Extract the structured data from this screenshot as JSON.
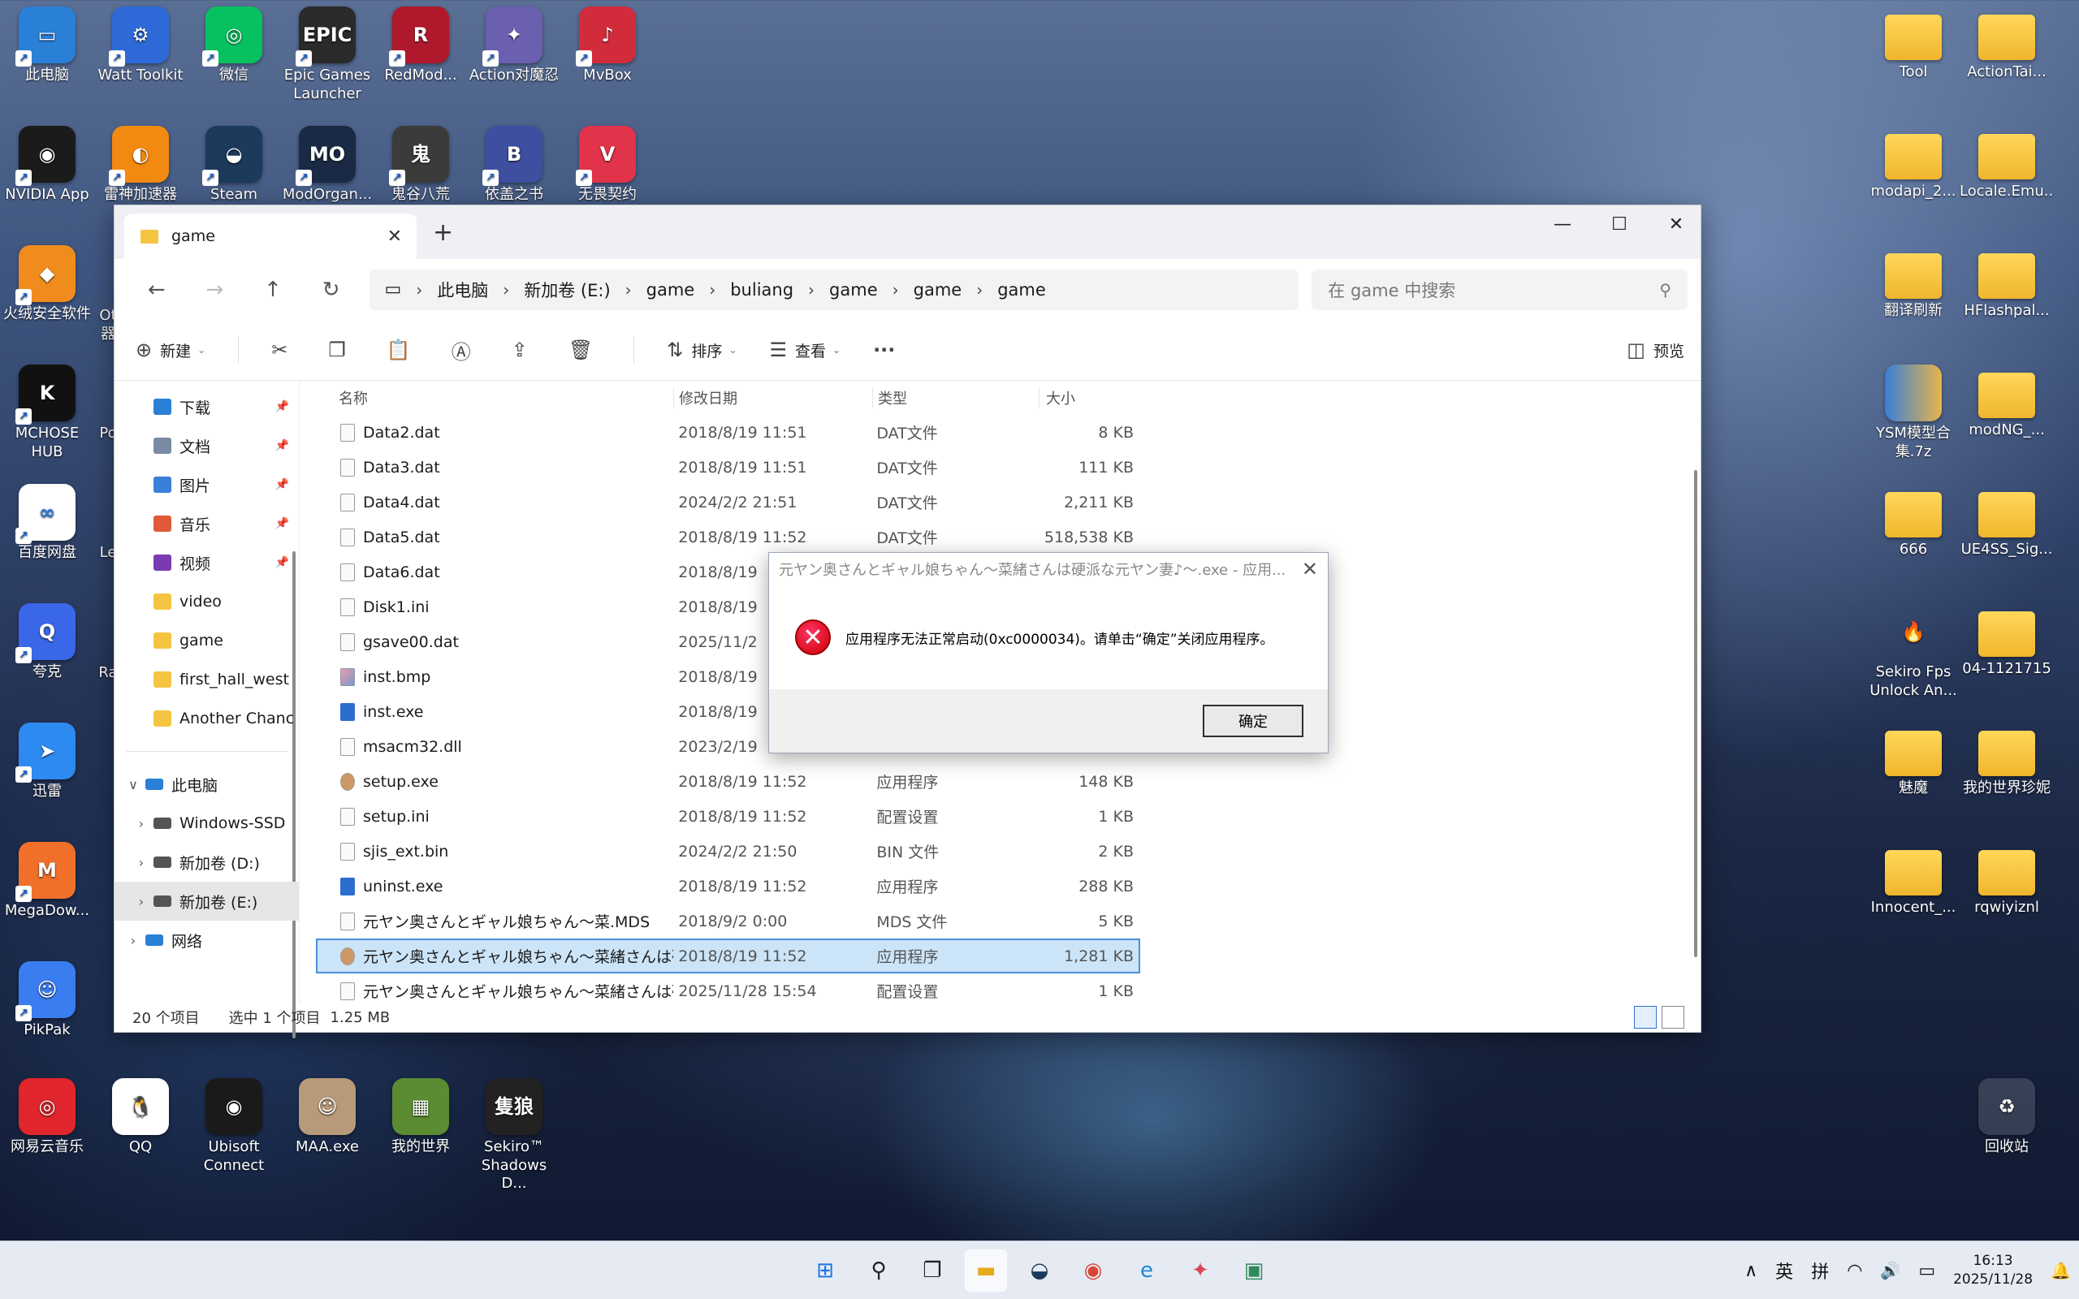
{
  "desktop": {
    "left_icons": [
      {
        "label": "此电脑",
        "icon": "computer-icon",
        "color": "#2a7fd6",
        "glyph": "▭"
      },
      {
        "label": "Watt Toolkit",
        "icon": "watt-toolkit-icon",
        "color": "#2d6ad8",
        "glyph": "⚙"
      },
      {
        "label": "微信",
        "icon": "wechat-icon",
        "color": "#07c160",
        "glyph": "◎"
      },
      {
        "label": "Epic Games Launcher",
        "icon": "epic-games-icon",
        "color": "#2a2a2a",
        "glyph": "EPIC"
      },
      {
        "label": "RedMod...",
        "icon": "redmod-icon",
        "color": "#b0182c",
        "glyph": "R"
      },
      {
        "label": "Action对魔忍",
        "icon": "action-game-icon",
        "color": "#6b5fb0",
        "glyph": "✦"
      },
      {
        "label": "MvBox",
        "icon": "mvbox-icon",
        "color": "#d22c3c",
        "glyph": "♪"
      },
      {
        "label": "NVIDIA App",
        "icon": "nvidia-icon",
        "color": "#1b1b1b",
        "glyph": "◉"
      },
      {
        "label": "雷神加速器",
        "icon": "leishen-icon",
        "color": "#f28a12",
        "glyph": "◐"
      },
      {
        "label": "Steam",
        "icon": "steam-icon",
        "color": "#1b3a5c",
        "glyph": "◒"
      },
      {
        "label": "ModOrgan...",
        "icon": "mod-organizer-icon",
        "color": "#1a2a44",
        "glyph": "MO"
      },
      {
        "label": "鬼谷八荒",
        "icon": "guigu-icon",
        "color": "#3b3b3b",
        "glyph": "鬼"
      },
      {
        "label": "依盖之书",
        "icon": "yigai-icon",
        "color": "#3e4fa0",
        "glyph": "B"
      },
      {
        "label": "无畏契约",
        "icon": "valorant-icon",
        "color": "#e1334a",
        "glyph": "V"
      },
      {
        "label": "火绒安全软件",
        "icon": "huorong-icon",
        "color": "#f08c1e",
        "glyph": "◆"
      },
      {
        "label": "MCHOSE HUB",
        "icon": "mchose-icon",
        "color": "#111111",
        "glyph": "K"
      },
      {
        "label": "百度网盘",
        "icon": "baidu-netdisk-icon",
        "color": "#ffffff",
        "glyph": "∞"
      },
      {
        "label": "夸克",
        "icon": "quark-icon",
        "color": "#3a67e8",
        "glyph": "Q"
      },
      {
        "label": "迅雷",
        "icon": "xunlei-icon",
        "color": "#2d8af0",
        "glyph": "➤"
      },
      {
        "label": "MegaDow...",
        "icon": "megadownloader-icon",
        "color": "#f0702a",
        "glyph": "M"
      },
      {
        "label": "PikPak",
        "icon": "pikpak-icon",
        "color": "#3a7df0",
        "glyph": "☺"
      }
    ],
    "partial_labels": [
      "Ot 器",
      "Po",
      "Le",
      "Ra"
    ],
    "bottom_icons": [
      {
        "label": "网易云音乐",
        "icon": "netease-music-icon",
        "color": "#e0262c",
        "glyph": "◎"
      },
      {
        "label": "QQ",
        "icon": "qq-icon",
        "color": "#ffffff",
        "glyph": "🐧"
      },
      {
        "label": "Ubisoft Connect",
        "icon": "ubisoft-icon",
        "color": "#1a1a1a",
        "glyph": "◉"
      },
      {
        "label": "MAA.exe",
        "icon": "maa-icon",
        "color": "#b89a7a",
        "glyph": "☺"
      },
      {
        "label": "我的世界",
        "icon": "minecraft-icon",
        "color": "#5b8c32",
        "glyph": "▦"
      },
      {
        "label": "Sekiro™ Shadows D...",
        "icon": "sekiro-icon",
        "color": "#222222",
        "glyph": "隻狼"
      }
    ],
    "right_icons": [
      {
        "label": "Tool",
        "icon": "folder-icon"
      },
      {
        "label": "ActionTai...",
        "icon": "folder-icon"
      },
      {
        "label": "modapi_2...",
        "icon": "folder-icon"
      },
      {
        "label": "Locale.Emu...",
        "icon": "folder-icon"
      },
      {
        "label": "翻译刷新",
        "icon": "folder-icon"
      },
      {
        "label": "HFlashpal...",
        "icon": "folder-icon"
      },
      {
        "label": "YSM模型合集.7z",
        "icon": "archive-icon"
      },
      {
        "label": "modNG_...",
        "icon": "folder-icon"
      },
      {
        "label": "666",
        "icon": "folder-icon"
      },
      {
        "label": "UE4SS_Sig...",
        "icon": "folder-icon"
      },
      {
        "label": "Sekiro Fps Unlock An...",
        "icon": "sekiro-fps-icon"
      },
      {
        "label": "04-1121715",
        "icon": "folder-icon"
      },
      {
        "label": "魅魔",
        "icon": "folder-icon"
      },
      {
        "label": "我的世界珍妮",
        "icon": "folder-icon"
      },
      {
        "label": "Innocent_...",
        "icon": "folder-icon"
      },
      {
        "label": "rqwiyiznl",
        "icon": "folder-icon"
      },
      {
        "label": "回收站",
        "icon": "recycle-bin-icon"
      }
    ]
  },
  "explorer": {
    "tab_title": "game",
    "breadcrumb": [
      "此电脑",
      "新加卷 (E:)",
      "game",
      "buliang",
      "game",
      "game",
      "game"
    ],
    "search_placeholder": "在 game 中搜索",
    "toolbar": {
      "new": "新建",
      "sort": "排序",
      "view": "查看",
      "more": "···",
      "preview": "预览"
    },
    "sidebar": [
      {
        "label": "下载",
        "icon": "download-icon",
        "color": "#2a7fd6",
        "pinned": true
      },
      {
        "label": "文档",
        "icon": "documents-icon",
        "color": "#7a8aa0",
        "pinned": true
      },
      {
        "label": "图片",
        "icon": "pictures-icon",
        "color": "#3a7fd8",
        "pinned": true
      },
      {
        "label": "音乐",
        "icon": "music-icon",
        "color": "#e05a3a",
        "pinned": true
      },
      {
        "label": "视频",
        "icon": "videos-icon",
        "color": "#7a3ab0",
        "pinned": true
      },
      {
        "label": "video",
        "icon": "folder-icon",
        "color": "#f5c542",
        "pinned": false
      },
      {
        "label": "game",
        "icon": "folder-icon",
        "color": "#f5c542",
        "pinned": false
      },
      {
        "label": "first_hall_west",
        "icon": "folder-icon",
        "color": "#f5c542",
        "pinned": false
      },
      {
        "label": "Another Chanc",
        "icon": "folder-icon",
        "color": "#f5c542",
        "pinned": false
      }
    ],
    "tree": [
      {
        "label": "此电脑",
        "chev": "∨",
        "icon": "computer-icon",
        "color": "#2a7fd6",
        "indent": 0,
        "selected": false
      },
      {
        "label": "Windows-SSD",
        "chev": "›",
        "icon": "drive-icon",
        "color": "#555555",
        "indent": 1,
        "selected": false
      },
      {
        "label": "新加卷 (D:)",
        "chev": "›",
        "icon": "drive-icon",
        "color": "#555555",
        "indent": 1,
        "selected": false
      },
      {
        "label": "新加卷 (E:)",
        "chev": "›",
        "icon": "drive-icon",
        "color": "#555555",
        "indent": 1,
        "selected": true
      },
      {
        "label": "网络",
        "chev": "›",
        "icon": "network-icon",
        "color": "#2a7fd6",
        "indent": 0,
        "selected": false
      }
    ],
    "columns": {
      "name": "名称",
      "modified": "修改日期",
      "type": "类型",
      "size": "大小"
    },
    "files": [
      {
        "name": "Data2.dat",
        "modified": "2018/8/19 11:51",
        "type": "DAT文件",
        "size": "8 KB",
        "kind": "file"
      },
      {
        "name": "Data3.dat",
        "modified": "2018/8/19 11:51",
        "type": "DAT文件",
        "size": "111 KB",
        "kind": "file"
      },
      {
        "name": "Data4.dat",
        "modified": "2024/2/2 21:51",
        "type": "DAT文件",
        "size": "2,211 KB",
        "kind": "file"
      },
      {
        "name": "Data5.dat",
        "modified": "2018/8/19 11:52",
        "type": "DAT文件",
        "size": "518,538 KB",
        "kind": "file"
      },
      {
        "name": "Data6.dat",
        "modified": "2018/8/19",
        "type": "",
        "size": "",
        "kind": "file"
      },
      {
        "name": "Disk1.ini",
        "modified": "2018/8/19",
        "type": "",
        "size": "",
        "kind": "file"
      },
      {
        "name": "gsave00.dat",
        "modified": "2025/11/2",
        "type": "",
        "size": "",
        "kind": "file"
      },
      {
        "name": "inst.bmp",
        "modified": "2018/8/19",
        "type": "",
        "size": "",
        "kind": "img"
      },
      {
        "name": "inst.exe",
        "modified": "2018/8/19",
        "type": "",
        "size": "",
        "kind": "exe"
      },
      {
        "name": "msacm32.dll",
        "modified": "2023/2/19",
        "type": "",
        "size": "",
        "kind": "file"
      },
      {
        "name": "setup.exe",
        "modified": "2018/8/19 11:52",
        "type": "应用程序",
        "size": "148 KB",
        "kind": "app"
      },
      {
        "name": "setup.ini",
        "modified": "2018/8/19 11:52",
        "type": "配置设置",
        "size": "1 KB",
        "kind": "file"
      },
      {
        "name": "sjis_ext.bin",
        "modified": "2024/2/2 21:50",
        "type": "BIN 文件",
        "size": "2 KB",
        "kind": "file"
      },
      {
        "name": "uninst.exe",
        "modified": "2018/8/19 11:52",
        "type": "应用程序",
        "size": "288 KB",
        "kind": "exe"
      },
      {
        "name": "元ヤン奥さんとギャル娘ちゃん～菜.MDS",
        "modified": "2018/9/2 0:00",
        "type": "MDS 文件",
        "size": "5 KB",
        "kind": "file"
      },
      {
        "name": "元ヤン奥さんとギャル娘ちゃん～菜緒さんは硬...",
        "modified": "2018/8/19 11:52",
        "type": "应用程序",
        "size": "1,281 KB",
        "kind": "app",
        "selected": true
      },
      {
        "name": "元ヤン奥さんとギャル娘ちゃん～菜緒さんは硬...",
        "modified": "2025/11/28 15:54",
        "type": "配置设置",
        "size": "1 KB",
        "kind": "file"
      }
    ],
    "status": {
      "count": "20 个项目",
      "selected": "选中 1 个项目",
      "size": "1.25 MB"
    }
  },
  "dialog": {
    "title": "元ヤン奥さんとギャル娘ちゃん～菜緒さんは硬派な元ヤン妻♪～.exe - 应用...",
    "message": "应用程序无法正常启动(0xc0000034)。请单击“确定”关闭应用程序。",
    "ok": "确定"
  },
  "taskbar": {
    "apps": [
      {
        "icon": "start-icon",
        "glyph": "⊞",
        "color": "#1a73e8"
      },
      {
        "icon": "search-icon",
        "glyph": "⚲",
        "color": "#222222"
      },
      {
        "icon": "task-view-icon",
        "glyph": "❐",
        "color": "#222222"
      },
      {
        "icon": "file-explorer-icon",
        "glyph": "▬",
        "color": "#e8a81c",
        "active": true
      },
      {
        "icon": "steam-icon",
        "glyph": "◒",
        "color": "#1b3a5c"
      },
      {
        "icon": "chrome-icon",
        "glyph": "◉",
        "color": "#db4437"
      },
      {
        "icon": "edge-icon",
        "glyph": "e",
        "color": "#1e88d6"
      },
      {
        "icon": "app-red-icon",
        "glyph": "✦",
        "color": "#d9465a"
      },
      {
        "icon": "app-window-icon",
        "glyph": "▣",
        "color": "#2f8a5a"
      }
    ],
    "tray": {
      "chevron": "∧",
      "lang1": "英",
      "lang2": "拼",
      "wifi": "◠",
      "volume": "🔊",
      "battery": "▭"
    },
    "time": "16:13",
    "date": "2025/11/28"
  }
}
